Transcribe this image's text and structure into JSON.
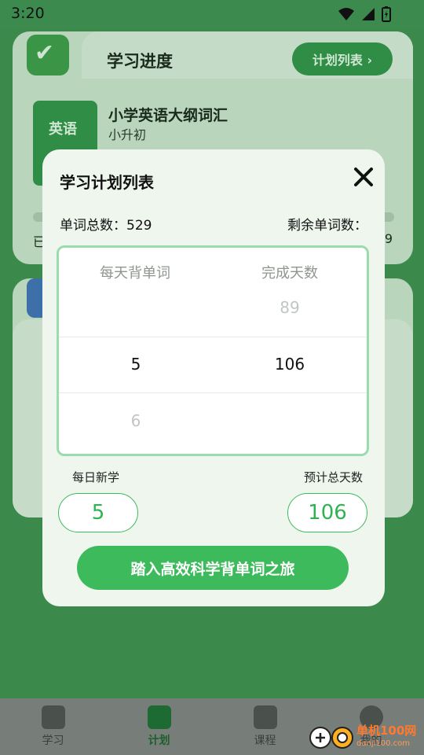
{
  "status": {
    "time": "3:20"
  },
  "background": {
    "progress_title": "学习进度",
    "plan_list_button": "计划列表 ›",
    "book_cover_text": "英语",
    "book_title": "小学英语大纲词汇",
    "book_subtitle": "小升初",
    "progress_left": "已",
    "progress_right": "29"
  },
  "modal": {
    "title": "学习计划列表",
    "total_words": "单词总数：529",
    "remaining_words": "剩余单词数：",
    "picker": {
      "col_left_head": "每天背单词",
      "col_right_head": "完成天数",
      "prev_left": "",
      "prev_right": "89",
      "sel_left": "5",
      "sel_right": "106",
      "next_left": "6",
      "next_right": ""
    },
    "daily_new_label": "每日新学",
    "total_days_label": "预计总天数",
    "daily_value": "5",
    "days_value": "106",
    "cta": "踏入高效科学背单词之旅"
  },
  "tabs": [
    {
      "label": "学习",
      "icon": "book-icon",
      "active": false
    },
    {
      "label": "计划",
      "icon": "plan-icon",
      "active": true
    },
    {
      "label": "课程",
      "icon": "course-icon",
      "active": false
    },
    {
      "label": "我的",
      "icon": "profile-icon",
      "active": false
    }
  ],
  "watermark": {
    "text": "单机100网",
    "sub": "danji100.com"
  },
  "colors": {
    "accent": "#3dba5b",
    "overlay_green": "#3b8a4b"
  }
}
